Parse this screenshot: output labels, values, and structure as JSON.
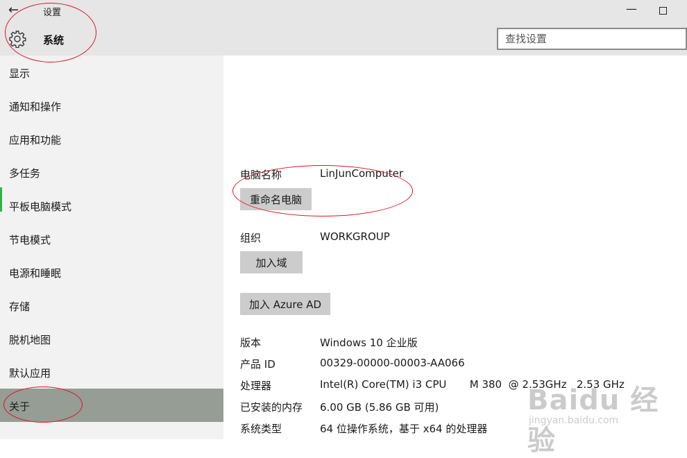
{
  "window": {
    "back_glyph": "←",
    "app_title": "设置",
    "minimize_glyph": "—"
  },
  "header": {
    "section_title": "系统",
    "search_placeholder": "查找设置"
  },
  "sidebar": {
    "items": [
      {
        "label": "显示"
      },
      {
        "label": "通知和操作"
      },
      {
        "label": "应用和功能"
      },
      {
        "label": "多任务"
      },
      {
        "label": "平板电脑模式"
      },
      {
        "label": "节电模式"
      },
      {
        "label": "电源和睡眠"
      },
      {
        "label": "存储"
      },
      {
        "label": "脱机地图"
      },
      {
        "label": "默认应用"
      },
      {
        "label": "关于",
        "active": true
      }
    ]
  },
  "about": {
    "pc_name_label": "电脑名称",
    "pc_name_value": "LinJunComputer",
    "rename_button": "重命名电脑",
    "org_label": "组织",
    "org_value": "WORKGROUP",
    "join_domain_button": "加入域",
    "join_azure_button": "加入 Azure AD",
    "specs": [
      {
        "label": "版本",
        "value": "Windows 10 企业版"
      },
      {
        "label": "产品 ID",
        "value": "00329-00000-00003-AA066"
      },
      {
        "label": "处理器",
        "value": "Intel(R) Core(TM) i3 CPU       M 380  @ 2.53GHz   2.53 GHz"
      },
      {
        "label": "已安装的内存",
        "value": "6.00 GB (5.86 GB 可用)"
      },
      {
        "label": "系统类型",
        "value": "64 位操作系统，基于 x64 的处理器"
      }
    ]
  },
  "watermark": {
    "brand": "Baidu 经验",
    "url": "jingyan.baidu.com"
  },
  "colors": {
    "titlebar_bg": "#e6e6e6",
    "sidebar_bg": "#f2f2f2",
    "active_item_bg": "#959d95",
    "button_bg": "#cccccc",
    "annotation_red": "#e0141e"
  }
}
